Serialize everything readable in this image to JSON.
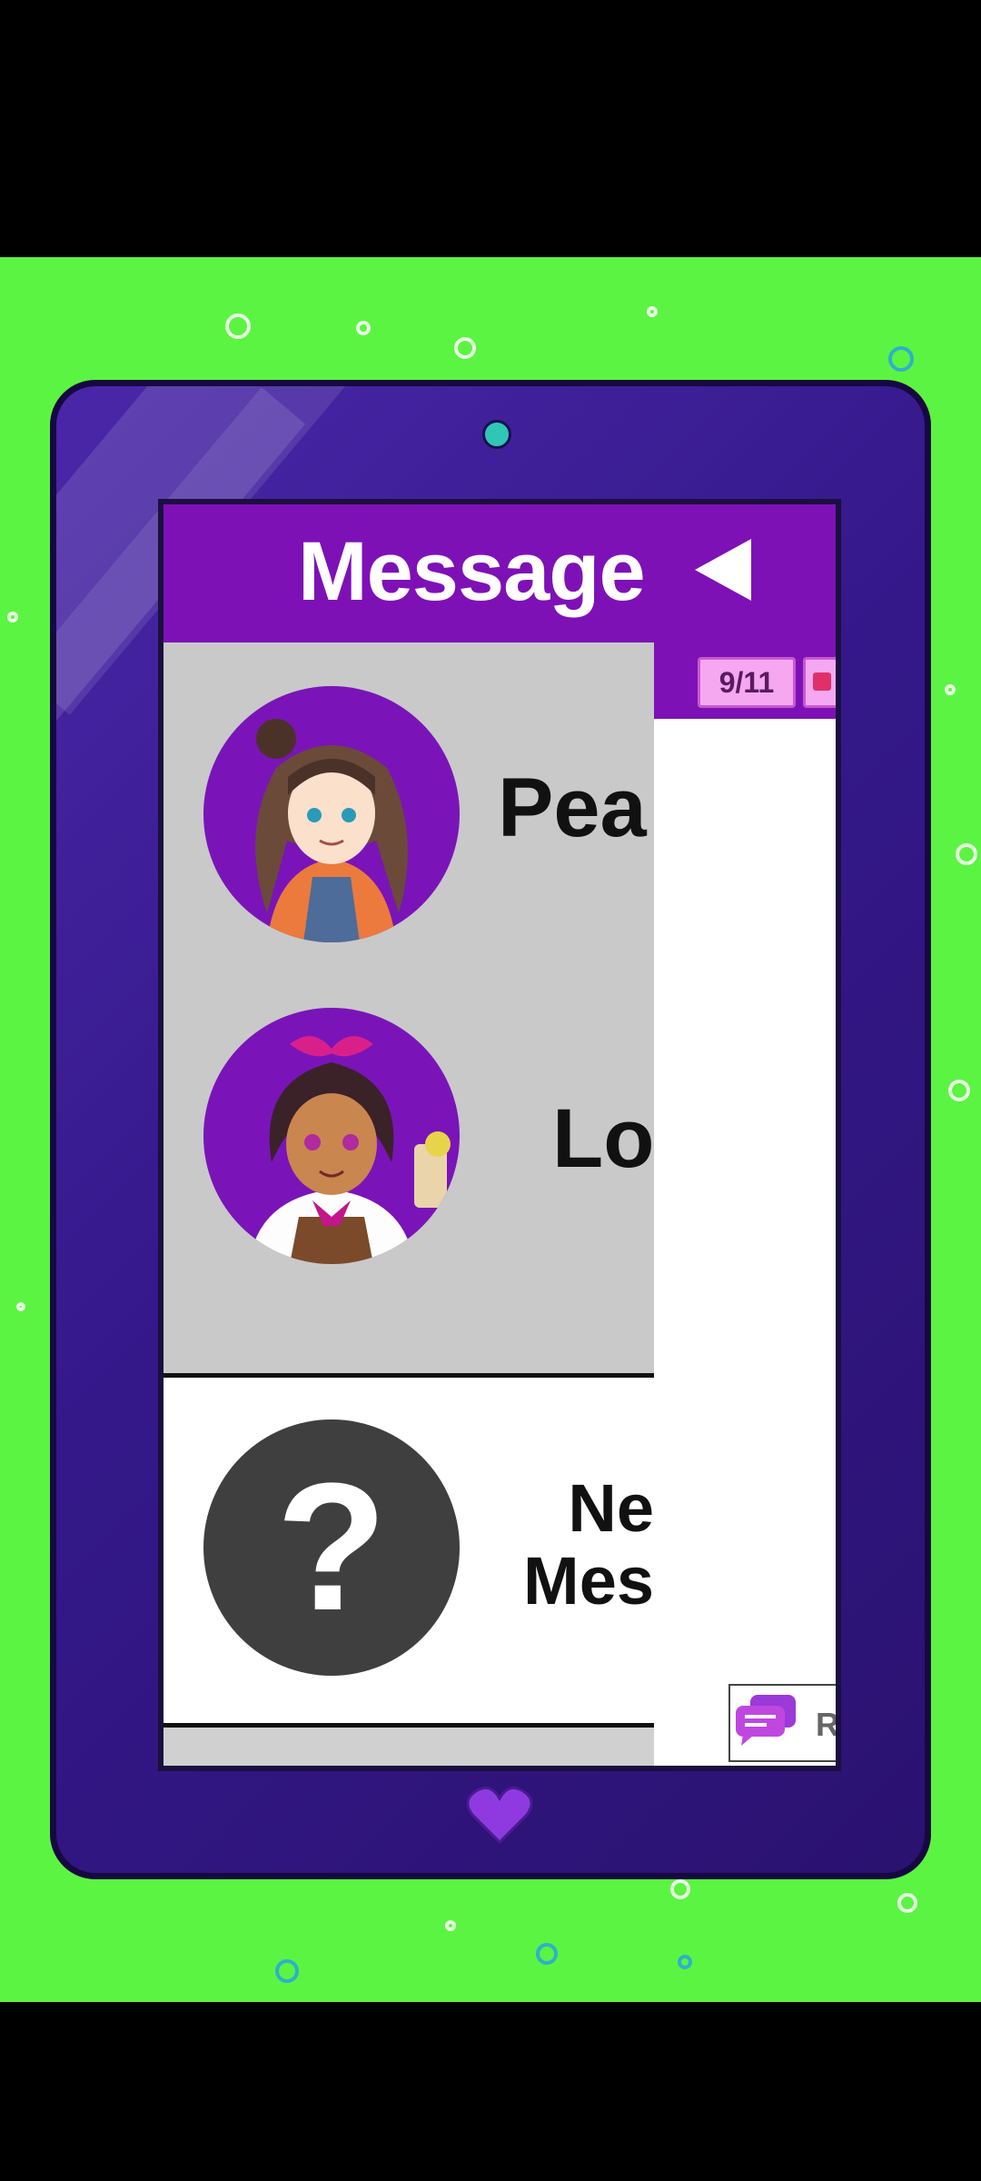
{
  "header": {
    "title": "Message"
  },
  "counter": {
    "label": "9/11"
  },
  "contacts": [
    {
      "name": "Pea"
    },
    {
      "name": "Lot"
    }
  ],
  "unknown": {
    "symbol": "?",
    "line1": "Ne",
    "line2": "Mes"
  },
  "reply": {
    "label": "Repl"
  },
  "colors": {
    "background": "#5cf442",
    "header": "#7e11b6",
    "tablet": "#3a1c95"
  }
}
